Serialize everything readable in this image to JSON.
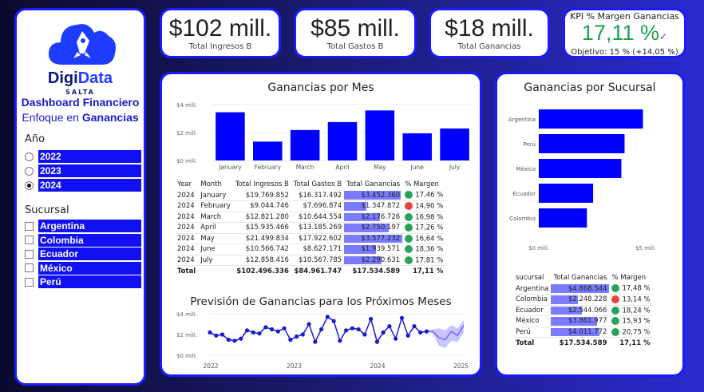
{
  "sidebar": {
    "logo": {
      "brand_a": "Digi",
      "brand_b": "Data",
      "sub": "SALTA"
    },
    "title_line1": "Dashboard Financiero",
    "title_line2_prefix": "Enfoque en ",
    "title_line2_bold": "Ganancias",
    "year_label": "Año",
    "years": [
      {
        "label": "2022",
        "selected": false
      },
      {
        "label": "2023",
        "selected": false
      },
      {
        "label": "2024",
        "selected": true
      }
    ],
    "branch_label": "Sucursal",
    "branches": [
      "Argentina",
      "Colombia",
      "Ecuador",
      "México",
      "Perú"
    ]
  },
  "kpis": {
    "ingresos": {
      "value": "$102 mill.",
      "label": "Total Ingresos B"
    },
    "gastos": {
      "value": "$85 mill.",
      "label": "Total Gastos B"
    },
    "ganancias": {
      "value": "$18 mill.",
      "label": "Total Ganancias"
    },
    "margen": {
      "title": "KPI % Margen Ganancias",
      "value": "17,11 %",
      "goal": "Objetivo: 15 % (+14,05 %)"
    }
  },
  "monthly": {
    "title": "Ganancias por Mes",
    "chart_data": {
      "type": "bar",
      "categories": [
        "January",
        "February",
        "March",
        "April",
        "May",
        "June",
        "July"
      ],
      "values": [
        3.45,
        1.35,
        2.18,
        2.75,
        3.58,
        1.94,
        2.29
      ],
      "ytick_labels": [
        "$0 mill.",
        "$2 mill.",
        "$4 mill."
      ],
      "ylim": [
        0,
        4
      ],
      "color": "#0000ff"
    },
    "table": {
      "headers": [
        "Year",
        "Month",
        "Total Ingresos B",
        "Total Gastos B",
        "Total Ganancias",
        "% Margen"
      ],
      "rows": [
        {
          "year": "2024",
          "month": "January",
          "ing": "$19.769.852",
          "gas": "$16.317.492",
          "gan": "$3.452.360",
          "gan_v": 3452360,
          "mar": "17,46 %",
          "ok": true
        },
        {
          "year": "2024",
          "month": "February",
          "ing": "$9.044.746",
          "gas": "$7.696.874",
          "gan": "$1.347.872",
          "gan_v": 1347872,
          "mar": "14,90 %",
          "ok": false
        },
        {
          "year": "2024",
          "month": "March",
          "ing": "$12.821.280",
          "gas": "$10.644.554",
          "gan": "$2.176.726",
          "gan_v": 2176726,
          "mar": "16,98 %",
          "ok": true
        },
        {
          "year": "2024",
          "month": "April",
          "ing": "$15.935.466",
          "gas": "$13.185.269",
          "gan": "$2.750.197",
          "gan_v": 2750197,
          "mar": "17,26 %",
          "ok": true
        },
        {
          "year": "2024",
          "month": "May",
          "ing": "$21.499.834",
          "gas": "$17.922.602",
          "gan": "$3.577.232",
          "gan_v": 3577232,
          "mar": "16,64 %",
          "ok": true
        },
        {
          "year": "2024",
          "month": "June",
          "ing": "$10.566.742",
          "gas": "$8.627.171",
          "gan": "$1.939.571",
          "gan_v": 1939571,
          "mar": "18,36 %",
          "ok": true
        },
        {
          "year": "2024",
          "month": "July",
          "ing": "$12.858.416",
          "gas": "$10.567.785",
          "gan": "$2.290.631",
          "gan_v": 2290631,
          "mar": "17,81 %",
          "ok": true
        }
      ],
      "total": {
        "label": "Total",
        "ing": "$102.496.336",
        "gas": "$84.961.747",
        "gan": "$17.534.589",
        "mar": "17,11 %"
      }
    }
  },
  "forecast": {
    "title": "Previsión de Ganancias para los Próximos Meses",
    "chart_data": {
      "type": "line",
      "xtick_labels": [
        "2022",
        "2023",
        "2024",
        "2025"
      ],
      "ytick_labels": [
        "$0 mill.",
        "$2 mill.",
        "$4 mill."
      ],
      "ylim": [
        0,
        4
      ],
      "actual": [
        2.2,
        1.9,
        2.0,
        1.5,
        1.4,
        1.6,
        2.4,
        2.2,
        2.1,
        2.7,
        2.5,
        2.3,
        2.6,
        1.5,
        1.8,
        2.0,
        3.0,
        1.3,
        2.5,
        3.7,
        3.3,
        1.4,
        2.4,
        2.6,
        2.5,
        2.0,
        3.5,
        1.3,
        2.2,
        2.8,
        1.6,
        3.6,
        1.9,
        2.8,
        2.2,
        2.3
      ],
      "forecast": [
        2.3,
        1.7,
        1.5,
        2.3,
        1.9,
        2.9
      ],
      "forecast_upper": [
        2.5,
        2.6,
        2.4,
        2.9,
        2.6,
        3.4
      ],
      "forecast_lower": [
        2.1,
        0.9,
        0.7,
        1.4,
        1.3,
        2.2
      ],
      "color": "#1a1ad0"
    }
  },
  "branch": {
    "title": "Ganancias por Sucursal",
    "chart_data": {
      "type": "bar",
      "categories": [
        "Argentina",
        "Perú",
        "México",
        "Ecuador",
        "Colombia"
      ],
      "values": [
        4.87,
        4.01,
        3.86,
        2.54,
        2.25
      ],
      "xtick_labels": [
        "$0 mill.",
        "$5 mill."
      ],
      "xlim": [
        0,
        5
      ],
      "color": "#0000ff"
    },
    "table": {
      "headers": [
        "sucursal",
        "Total Ganancias",
        "% Margen"
      ],
      "rows": [
        {
          "name": "Argentina",
          "gan": "$4.868.544",
          "gan_v": 4868544,
          "mar": "17,48 %",
          "ok": true
        },
        {
          "name": "Colombia",
          "gan": "$2.248.228",
          "gan_v": 2248228,
          "mar": "13,14 %",
          "ok": false
        },
        {
          "name": "Ecuador",
          "gan": "$2.544.066",
          "gan_v": 2544066,
          "mar": "18,24 %",
          "ok": true
        },
        {
          "name": "México",
          "gan": "$3.861.977",
          "gan_v": 3861977,
          "mar": "15,93 %",
          "ok": true
        },
        {
          "name": "Perú",
          "gan": "$4.011.772",
          "gan_v": 4011772,
          "mar": "20,75 %",
          "ok": true
        }
      ],
      "total": {
        "label": "Total",
        "gan": "$17.534.589",
        "mar": "17,11 %"
      }
    }
  }
}
